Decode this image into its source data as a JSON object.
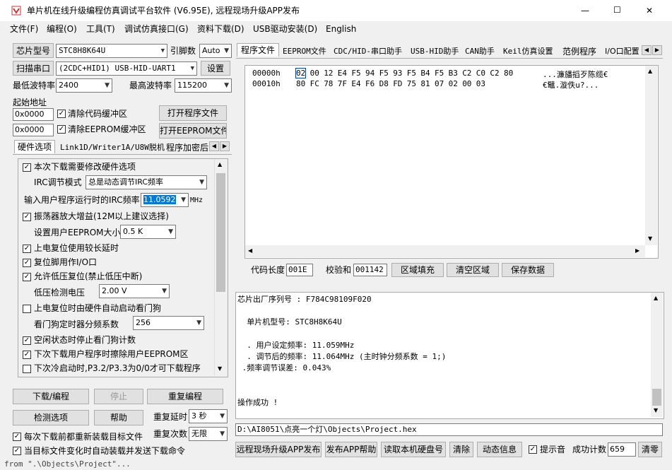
{
  "window": {
    "title": "单片机在线升级编程仿真调试平台软件 (V6.95E), 远程现场升级APP发布",
    "min": "—",
    "max": "☐",
    "close": "✕"
  },
  "menu": [
    "文件(F)",
    "编程(O)",
    "工具(T)",
    "调试仿真接口(G)",
    "资料下载(D)",
    "USB驱动安装(D)",
    "English"
  ],
  "left": {
    "chip_btn": "芯片型号",
    "chip_value": "STC8H8K64U",
    "pin_label": "引脚数",
    "pin_value": "Auto",
    "scan_btn": "扫描串口",
    "port_value": "(2CDC+HID1) USB-HID-UART1",
    "settings_btn": "设置",
    "min_baud_label": "最低波特率",
    "min_baud_value": "2400",
    "max_baud_label": "最高波特率",
    "max_baud_value": "115200",
    "start_addr_label": "起始地址",
    "addr1": "0x0000",
    "clear_code_label": "清除代码缓冲区",
    "open_prog_btn": "打开程序文件",
    "addr2": "0x0000",
    "clear_eeprom_label": "清除EEPROM缓冲区",
    "open_eeprom_btn": "打开EEPROM文件",
    "tabs": [
      "硬件选项",
      "Link1D/Writer1A/U8W脱机",
      "程序加密后"
    ],
    "opts": {
      "o1": "本次下载需要修改硬件选项",
      "irc_mode_label": "IRC调节模式",
      "irc_mode_value": "总是动态调节IRC频率",
      "irc_freq_label": "输入用户程序运行时的IRC频率",
      "irc_freq_value": "11.0592",
      "irc_unit": "MHz",
      "o2": "振荡器放大增益(12M以上建议选择)",
      "eeprom_size_label": "设置用户EEPROM大小",
      "eeprom_size_value": "0.5 K",
      "o3": "上电复位使用较长延时",
      "o4": "复位脚用作I/O口",
      "o5": "允许低压复位(禁止低压中断)",
      "lv_label": "低压检测电压",
      "lv_value": "2.00 V",
      "o6": "上电复位时由硬件自动启动看门狗",
      "wdt_label": "看门狗定时器分频系数",
      "wdt_value": "256",
      "o7": "空闲状态时停止看门狗计数",
      "o8": "下次下载用户程序时擦除用户EEPROM区",
      "o9": "下次冷启动时,P3.2/P3.3为0/0才可下载程序"
    },
    "download_btn": "下载/编程",
    "stop_btn": "停止",
    "reprog_btn": "重复编程",
    "check_btn": "检测选项",
    "help_btn": "帮助",
    "delay_label": "重复延时",
    "delay_value": "3 秒",
    "reload_label": "每次下载前都重新装载目标文件",
    "count_label": "重复次数",
    "count_value": "无限",
    "autoload_label": "当目标文件变化时自动装载并发送下载命令"
  },
  "right": {
    "tabs": [
      "程序文件",
      "EEPROM文件",
      "CDC/HID-串口助手",
      "USB-HID助手",
      "CAN助手",
      "Keil仿真设置",
      "范例程序",
      "I/O口配置"
    ],
    "hex": [
      {
        "addr": "00000h",
        "bytes": [
          "02",
          "00",
          "12",
          "E4",
          "F5",
          "94",
          "F5",
          "93",
          "F5",
          "B4",
          "F5",
          "B3",
          "C2",
          "C0",
          "C2",
          "80"
        ],
        "ascii": "...濂旙搯歹陈缆€"
      },
      {
        "addr": "00010h",
        "bytes": [
          "80",
          "FC",
          "78",
          "7F",
          "E4",
          "F6",
          "D8",
          "FD",
          "75",
          "81",
          "07",
          "02",
          "00",
          "03"
        ],
        "ascii": "€鼊.漩佚u?..."
      }
    ],
    "code_len_label": "代码长度",
    "code_len_value": "001E",
    "checksum_label": "校验和",
    "checksum_value": "001142",
    "fill_btn": "区域填充",
    "clear_area_btn": "清空区域",
    "save_btn": "保存数据",
    "log": [
      "芯片出厂序列号 : F784C98109F020",
      "",
      "  单片机型号: STC8H8K64U",
      "",
      "  . 用户设定频率: 11.059MHz",
      "  . 调节后的频率: 11.064MHz (主时钟分频系数 = 1;)",
      " .频率调节误差: 0.043%",
      "",
      "",
      "操作成功 !"
    ],
    "path": "D:\\AI8051\\点亮一个灯\\Objects\\Project.hex",
    "publish_btn": "远程现场升级APP发布",
    "publish_help_btn": "发布APP帮助",
    "read_disk_btn": "读取本机硬盘号",
    "clear_btn": "清除",
    "dyn_btn": "动态信息",
    "beep_label": "提示音",
    "success_label": "成功计数",
    "success_value": "659",
    "clear_count_btn": "清零"
  },
  "bg_text": "from \".\\Objects\\Project\"..."
}
